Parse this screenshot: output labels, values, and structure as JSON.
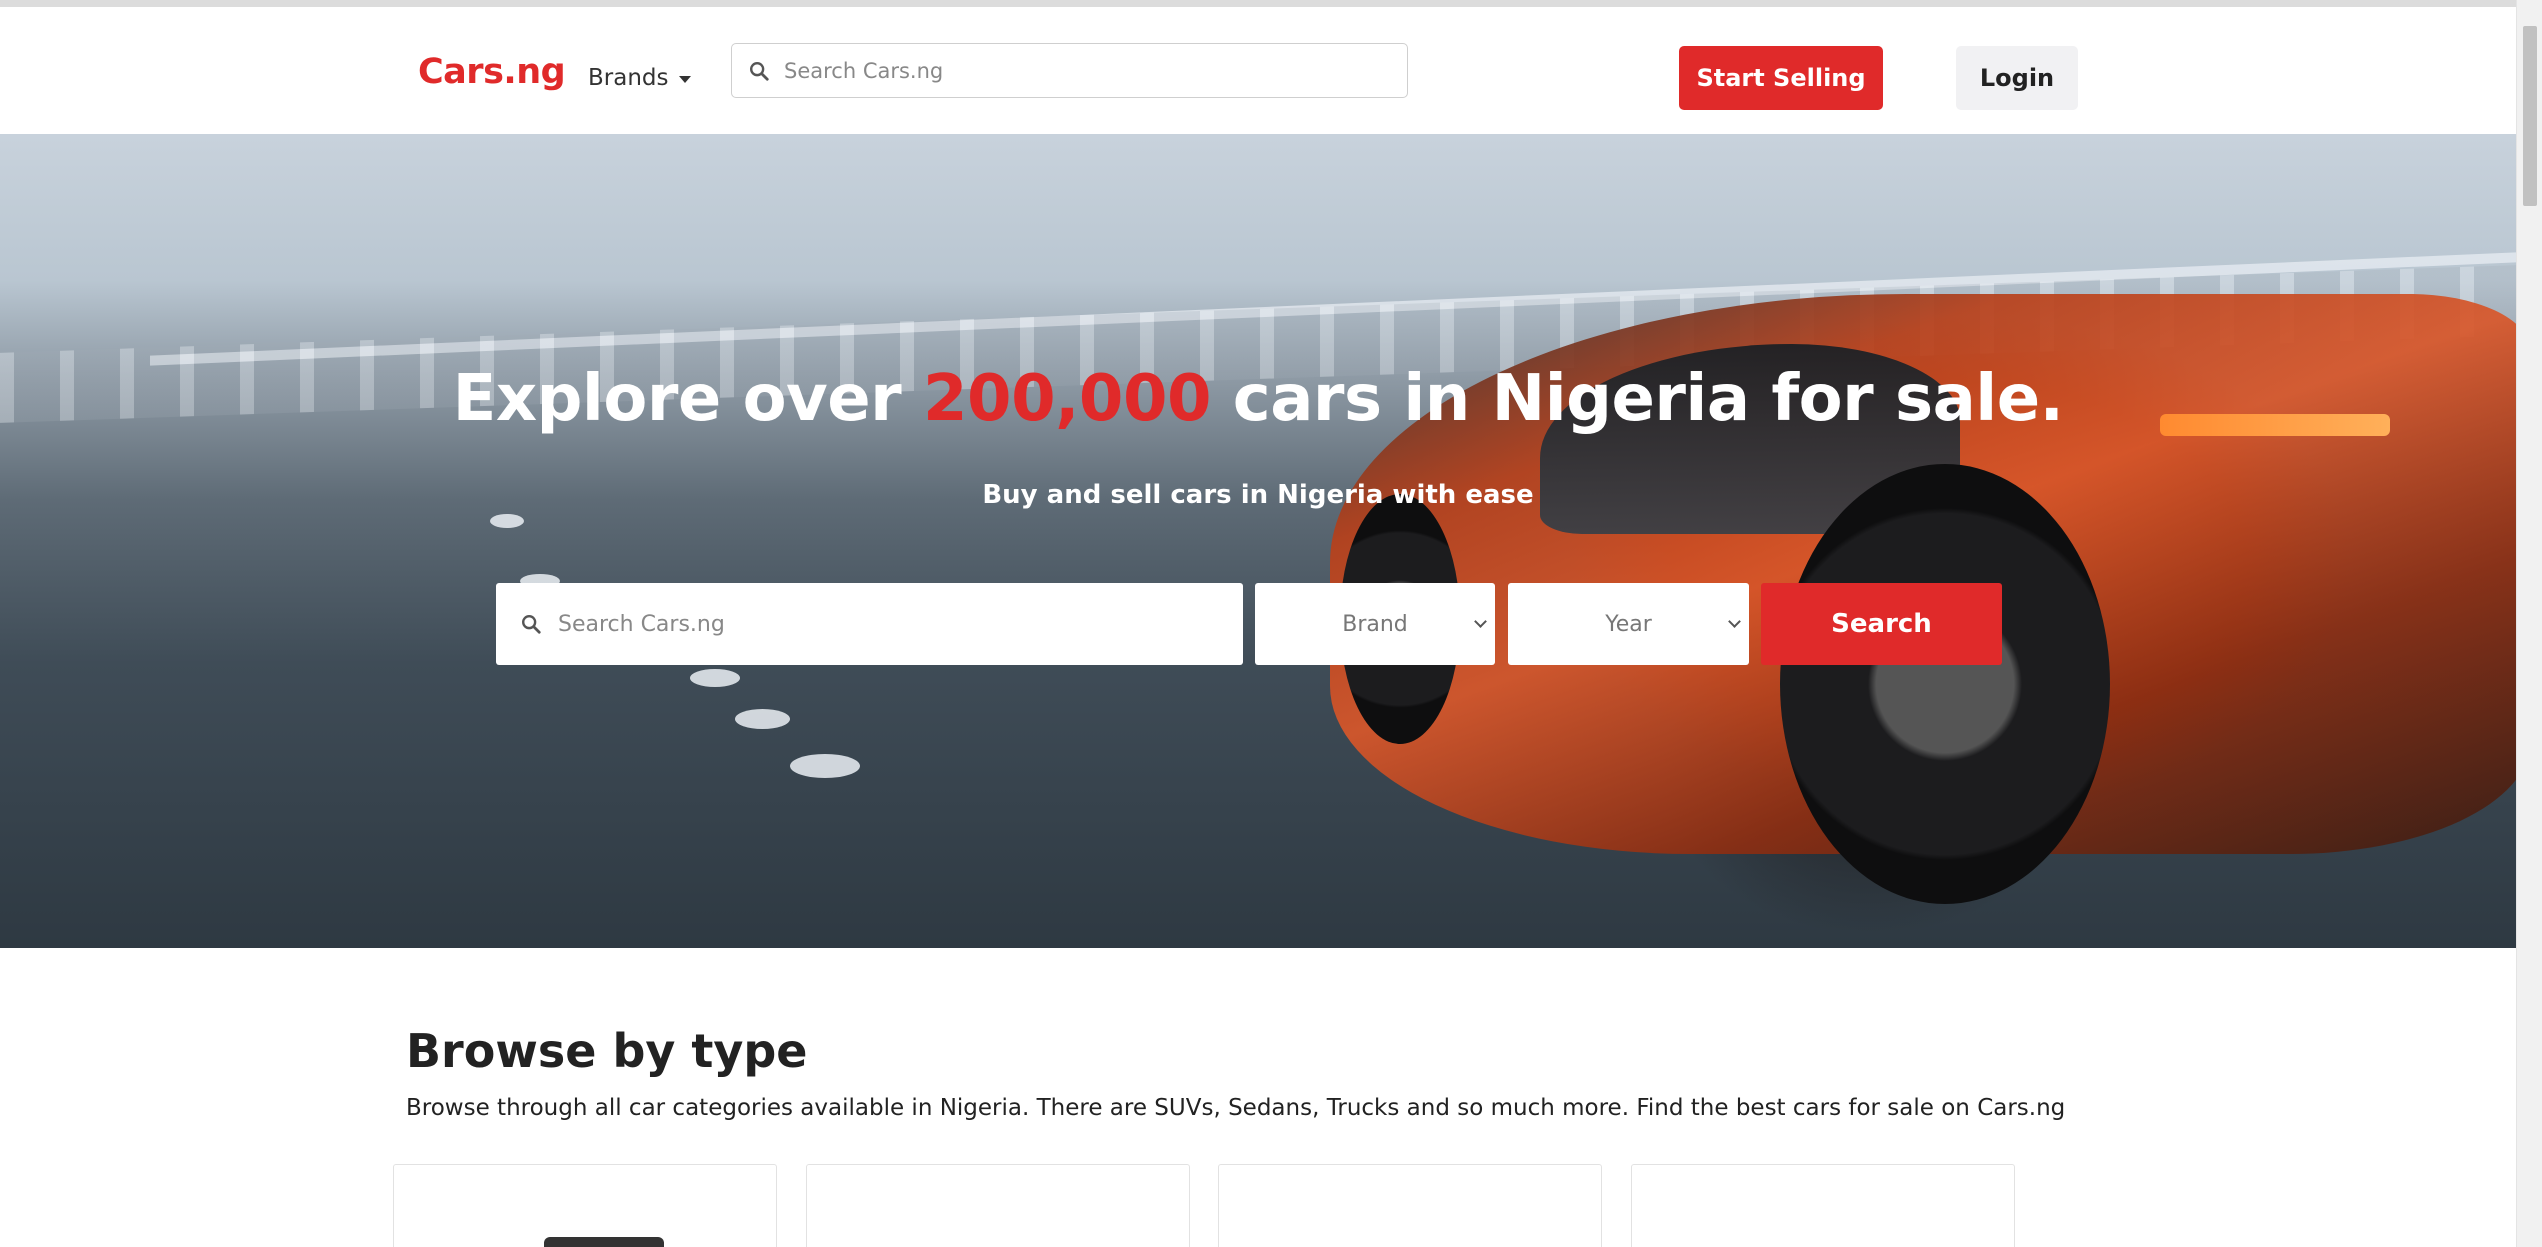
{
  "header": {
    "logo": "Cars.ng",
    "brands_label": "Brands",
    "search_placeholder": "Search Cars.ng",
    "start_selling_label": "Start Selling",
    "login_label": "Login"
  },
  "hero": {
    "title_prefix": "Explore over ",
    "title_highlight": "200,000",
    "title_suffix": " cars in Nigeria for sale.",
    "subtitle": "Buy and sell cars in Nigeria with ease",
    "search_placeholder": "Search Cars.ng",
    "brand_select": "Brand",
    "year_select": "Year",
    "search_button": "Search"
  },
  "browse": {
    "title": "Browse by type",
    "description": "Browse through all car categories available in Nigeria. There are SUVs, Sedans, Trucks and so much more. Find the best cars for sale on Cars.ng"
  },
  "colors": {
    "brand_red": "#e02a2a",
    "text_dark": "#222222",
    "login_bg": "#f1f1f3"
  },
  "icons": {
    "search": "search-icon",
    "dropdown": "chevron-down-icon"
  }
}
